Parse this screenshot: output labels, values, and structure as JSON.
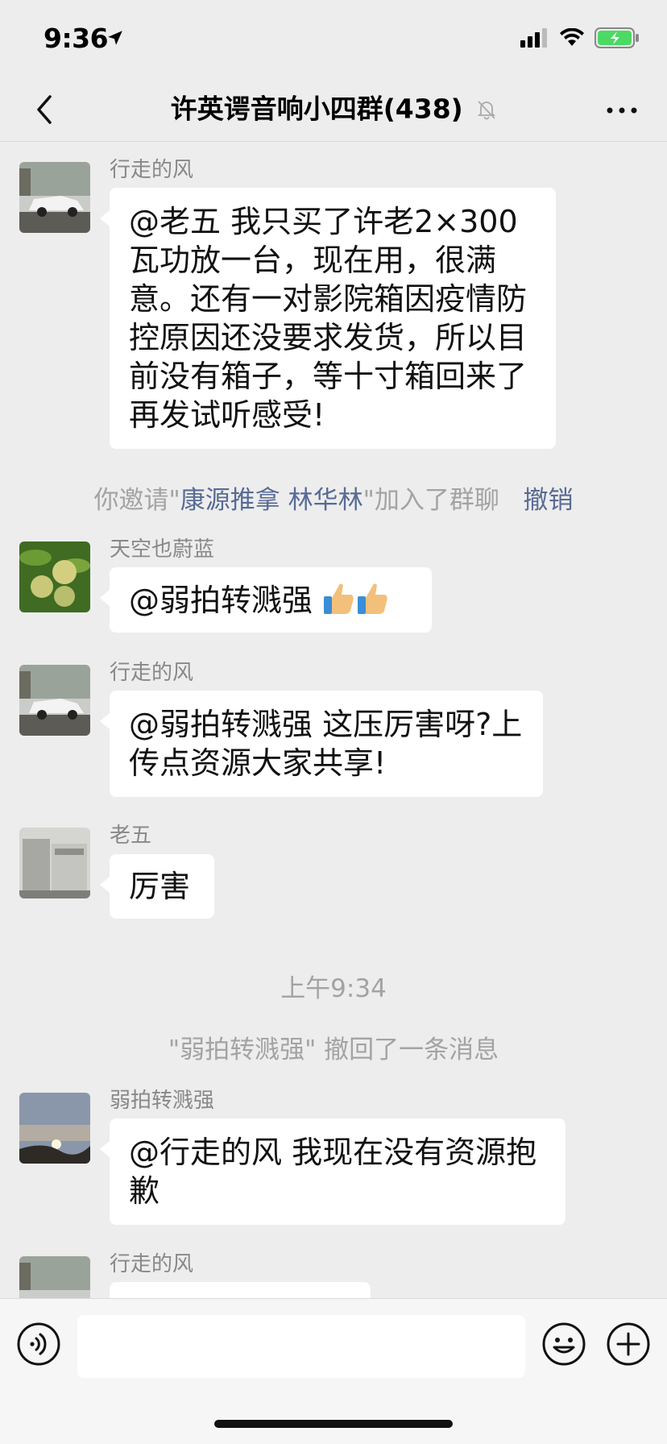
{
  "status": {
    "time": "9:36"
  },
  "nav": {
    "title": "许英谔音响小四群(438)"
  },
  "messages": [
    {
      "sender": "行走的风",
      "text": "@老五 我只买了许老2×300瓦功放一台，现在用，很满意。还有一对影院箱因疫情防控原因还没要求发货，所以目前没有箱子，等十寸箱回来了再发试听感受!"
    },
    {
      "sender": "天空也蔚蓝",
      "text": "@弱拍转溅强 "
    },
    {
      "sender": "行走的风",
      "text": "@弱拍转溅强 这压厉害呀?上传点资源大家共享!"
    },
    {
      "sender": "老五",
      "text": "厉害"
    },
    {
      "sender": "弱拍转溅强",
      "text": "@行走的风 我现在没有资源抱歉"
    },
    {
      "sender": "行走的风",
      "text": ""
    }
  ],
  "system": {
    "invite_prefix": "你邀请\"",
    "invite_names": "康源推拿 林华林",
    "invite_suffix": "\"加入了群聊",
    "undo": "撤销",
    "timestamp": "上午9:34",
    "recall": "\"弱拍转溅强\" 撤回了一条消息"
  },
  "icons": {
    "back": "chevron-left-icon",
    "mute": "bell-off-icon",
    "more": "more-dots-icon",
    "voice": "voice-icon",
    "emoji": "emoji-icon",
    "plus": "plus-icon",
    "thumbs": "thumbs-up-icon"
  },
  "colors": {
    "background": "#ededed",
    "bubble": "#ffffff",
    "link": "#576b95",
    "battery": "#4cd964"
  }
}
